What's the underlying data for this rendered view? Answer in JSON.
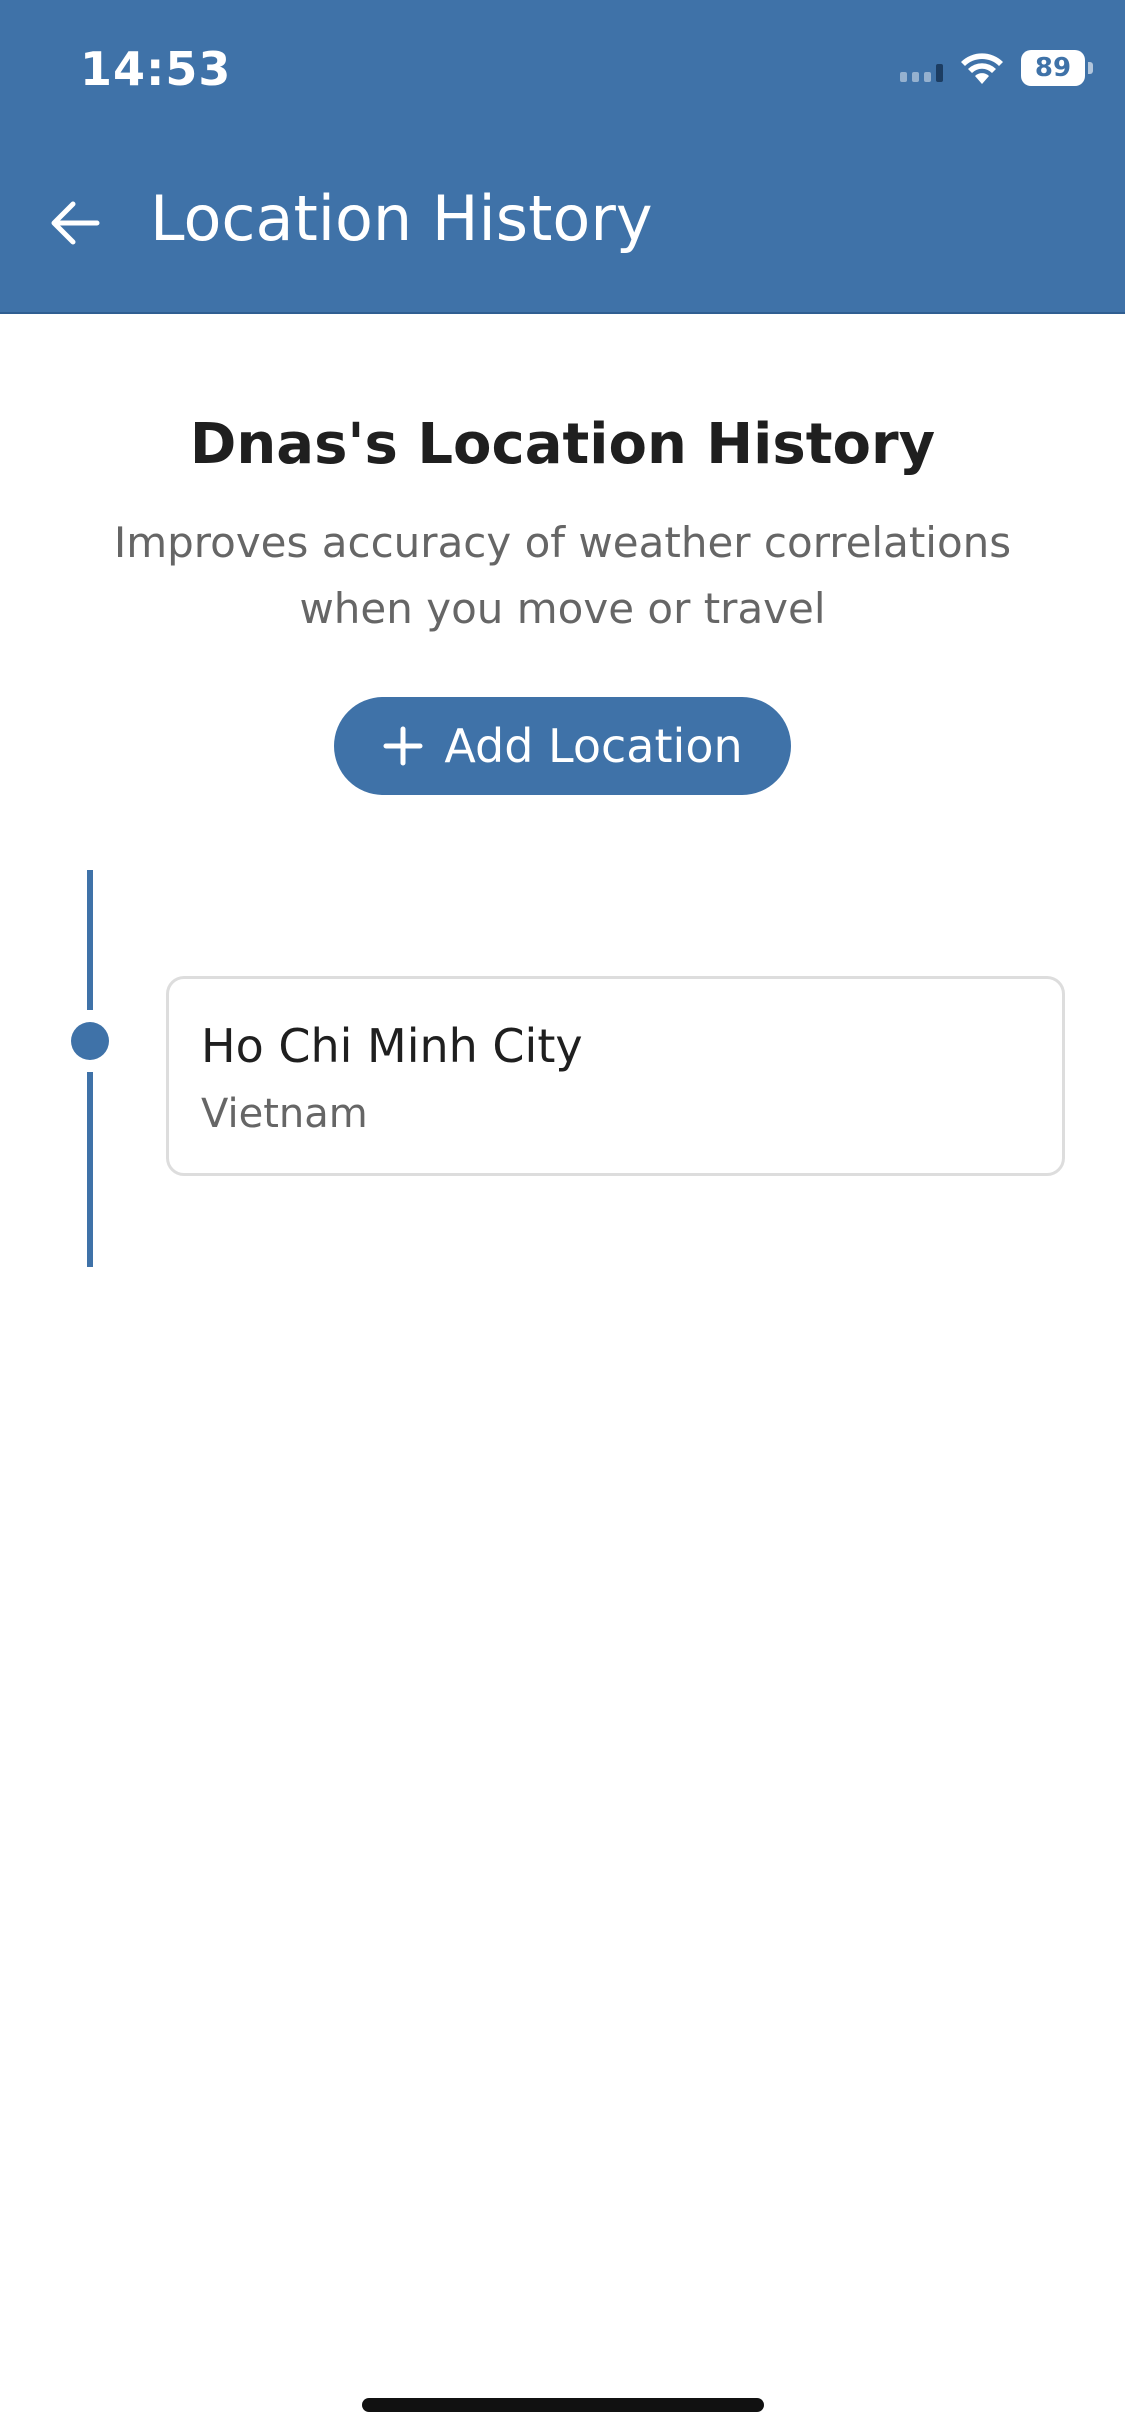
{
  "status_bar": {
    "time": "14:53",
    "battery": "89",
    "icons": [
      "signal-icon",
      "wifi-icon",
      "battery-icon"
    ]
  },
  "header": {
    "title": "Location History",
    "back_icon": "arrow-left-icon",
    "background_color": "#3f72a8"
  },
  "main": {
    "heading": "Dnas's Location History",
    "subtitle": "Improves accuracy of weather correlations when you move or travel",
    "add_button": {
      "label": "Add Location",
      "icon": "plus-icon"
    },
    "locations": [
      {
        "city": "Ho Chi Minh City",
        "country": "Vietnam"
      }
    ]
  },
  "colors": {
    "accent": "#3f72a8",
    "text_primary": "#1f1f1f",
    "text_secondary": "#666666",
    "card_border": "#dddddd"
  }
}
